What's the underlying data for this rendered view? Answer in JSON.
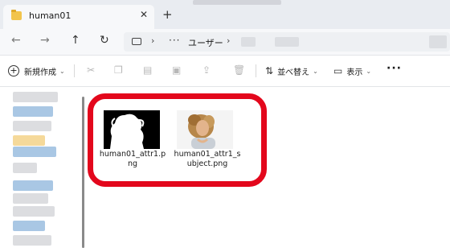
{
  "window": {
    "tab_title": "human01",
    "close_glyph": "✕",
    "new_tab_glyph": "+"
  },
  "navigation": {
    "back_glyph": "←",
    "forward_glyph": "→",
    "up_glyph": "↑",
    "refresh_glyph": "↻",
    "more_path_glyph": "···",
    "chevron_glyph": "›",
    "breadcrumb_user": "ユーザー"
  },
  "commandbar": {
    "new_label": "新規作成",
    "new_glyph": "+",
    "sort_label": "並べ替え",
    "view_label": "表示",
    "caret_glyph": "⌄",
    "more_glyph": "···"
  },
  "files": [
    {
      "name_line1": "human01_attr1.p",
      "name_line2": "ng",
      "thumbnail": "mask-silhouette"
    },
    {
      "name_line1": "human01_attr1_s",
      "name_line2": "ubject.png",
      "thumbnail": "portrait-photo"
    }
  ],
  "colors": {
    "highlight_ring": "#e3071c",
    "folder": "#f2c44c"
  }
}
